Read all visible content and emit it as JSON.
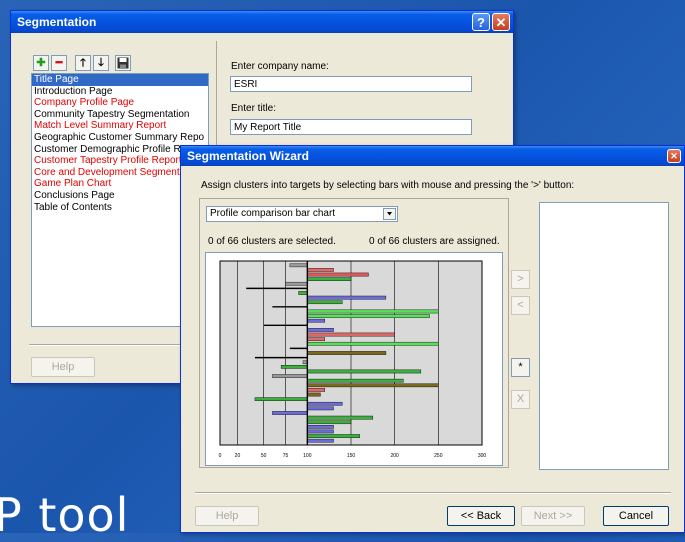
{
  "background_text": "P tool",
  "seg_window": {
    "title": "Segmentation",
    "pages": [
      {
        "label": "Title Page",
        "color": "black",
        "selected": true
      },
      {
        "label": "Introduction Page",
        "color": "black"
      },
      {
        "label": "Company Profile Page",
        "color": "red"
      },
      {
        "label": "Community Tapestry Segmentation",
        "color": "black"
      },
      {
        "label": "Match Level Summary Report",
        "color": "red"
      },
      {
        "label": "Geographic Customer Summary Repo",
        "color": "black"
      },
      {
        "label": "Customer Demographic Profile Re",
        "color": "black"
      },
      {
        "label": "Customer Tapestry Profile Report",
        "color": "red"
      },
      {
        "label": "Core and Development Segment",
        "color": "red"
      },
      {
        "label": "Game Plan Chart",
        "color": "red"
      },
      {
        "label": "Conclusions Page",
        "color": "black"
      },
      {
        "label": "Table of Contents",
        "color": "black"
      }
    ],
    "company_label": "Enter company name:",
    "company_value": "ESRI",
    "title_label": "Enter title:",
    "title_value": "My Report Title",
    "help_label": "Help"
  },
  "wizard": {
    "title": "Segmentation Wizard",
    "instruction": "Assign clusters into targets by selecting bars with mouse and pressing the '>' button:",
    "chart_select": "Profile comparison bar chart",
    "selected_status": "0 of 66 clusters are selected.",
    "assigned_status": "0 of 66 clusters are assigned.",
    "assign_btn": ">",
    "unassign_btn": "<",
    "star_btn": "*",
    "clear_btn": "X",
    "help_label": "Help",
    "back_label": "<< Back",
    "next_label": "Next >>",
    "cancel_label": "Cancel"
  },
  "chart_data": {
    "type": "bar",
    "orientation": "horizontal",
    "baseline": 100,
    "xlim": [
      0,
      300
    ],
    "xticks": [
      0,
      20,
      50,
      75,
      100,
      150,
      200,
      250,
      300
    ],
    "tick_labels": [
      "0",
      "20",
      "50",
      "75",
      "100",
      "150",
      "200",
      "250",
      "300"
    ],
    "bars": [
      {
        "v": 80,
        "c": "#9a9a9a"
      },
      {
        "v": 130,
        "c": "#e06a6a"
      },
      {
        "v": 170,
        "c": "#e05858"
      },
      {
        "v": 150,
        "c": "#3cb03c"
      },
      {
        "v": 75,
        "c": "#9a9a9a"
      },
      {
        "v": 30,
        "c": "#000000"
      },
      {
        "v": 90,
        "c": "#3cb03c"
      },
      {
        "v": 190,
        "c": "#6b6bd9"
      },
      {
        "v": 140,
        "c": "#3cb03c"
      },
      {
        "v": 60,
        "c": "#000000"
      },
      {
        "v": 250,
        "c": "#58e058"
      },
      {
        "v": 240,
        "c": "#58e058"
      },
      {
        "v": 120,
        "c": "#6b6bd9"
      },
      {
        "v": 50,
        "c": "#000000"
      },
      {
        "v": 130,
        "c": "#6b6bd9"
      },
      {
        "v": 200,
        "c": "#e06a6a"
      },
      {
        "v": 120,
        "c": "#e06a6a"
      },
      {
        "v": 250,
        "c": "#58e058"
      },
      {
        "v": 80,
        "c": "#000000"
      },
      {
        "v": 190,
        "c": "#7a6a20"
      },
      {
        "v": 40,
        "c": "#000000"
      },
      {
        "v": 95,
        "c": "#9a9a9a"
      },
      {
        "v": 70,
        "c": "#3cb03c"
      },
      {
        "v": 230,
        "c": "#3cb03c"
      },
      {
        "v": 60,
        "c": "#9a9a9a"
      },
      {
        "v": 210,
        "c": "#3cb03c"
      },
      {
        "v": 250,
        "c": "#7a6a20"
      },
      {
        "v": 120,
        "c": "#e06a6a"
      },
      {
        "v": 115,
        "c": "#7a6a20"
      },
      {
        "v": 40,
        "c": "#3cb03c"
      },
      {
        "v": 140,
        "c": "#6b6bd9"
      },
      {
        "v": 130,
        "c": "#6b6bd9"
      },
      {
        "v": 60,
        "c": "#6b6bd9"
      },
      {
        "v": 175,
        "c": "#3cb03c"
      },
      {
        "v": 150,
        "c": "#3cb03c"
      },
      {
        "v": 130,
        "c": "#6b6bd9"
      },
      {
        "v": 130,
        "c": "#6b6bd9"
      },
      {
        "v": 160,
        "c": "#3cb03c"
      },
      {
        "v": 130,
        "c": "#6b6bd9"
      }
    ]
  }
}
